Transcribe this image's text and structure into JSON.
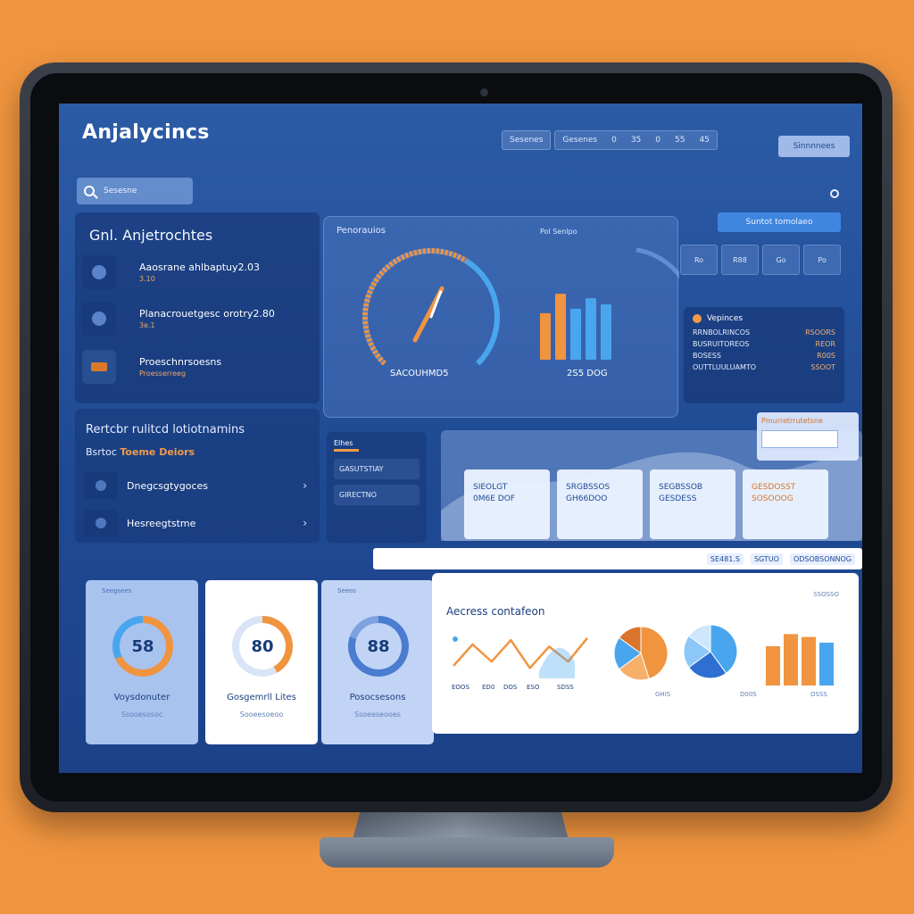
{
  "app": {
    "title": "Anjalycincs"
  },
  "topnav": {
    "items": [
      "Sesenes",
      "Gesenes",
      "0",
      "35",
      "0",
      "55",
      "45"
    ],
    "signin": "Sinnnnees"
  },
  "search": {
    "placeholder": "Sesesne"
  },
  "left_panel": {
    "title": "Gnl. Anjetrochtes",
    "items": [
      {
        "title": "Aaosrane ahlbaptuy2.03",
        "sub": "3.10"
      },
      {
        "title": "Planacrouetgesc orotry2.80",
        "sub": "3e.1"
      },
      {
        "title": "Proeschnrsoesns",
        "sub": "Proesserreeg"
      }
    ]
  },
  "report_panel": {
    "title": "Rertcbr rulitcd lotiotnamins",
    "sub_plain": "Bsrtoc",
    "sub_accent": "Toeme Deiors",
    "rows": [
      "Dnegcsgtygoces",
      "Hesreegtstme"
    ]
  },
  "performance": {
    "title": "Penorauios",
    "side": "Pol   Senlpo",
    "gauge_label": "SACOUHMD5",
    "bar_label": "2S5 DOG",
    "gauge": {
      "value": 0.62
    },
    "bars": [
      {
        "value": 0.62,
        "color": "#f0943f"
      },
      {
        "value": 0.88,
        "color": "#f0943f"
      },
      {
        "value": 0.68,
        "color": "#49a6ee"
      },
      {
        "value": 0.82,
        "color": "#49a6ee"
      },
      {
        "value": 0.74,
        "color": "#49a6ee"
      }
    ]
  },
  "right": {
    "update_button": "Suntot tomolaeo",
    "mini_stats": [
      "Ro",
      "R88",
      "Go",
      "Po"
    ],
    "news_title": "Vepinces",
    "news_rows": [
      {
        "left": "RRNBOLRINCOS",
        "right": "RSOORS"
      },
      {
        "left": "BUSRUITOREOS",
        "right": "REOR"
      },
      {
        "left": "BOSESS",
        "right": "R00S"
      },
      {
        "left": "OUTTLUULUAMTO",
        "right": "SSOOT"
      }
    ]
  },
  "mini_list": {
    "title": "Elhes",
    "rows": [
      "GASUTSTIAY",
      "GIRECTNO"
    ]
  },
  "kpi": {
    "chip_label": "Pmurretrrutetsne",
    "cards": [
      {
        "line1": "SIEOLGT",
        "line2": "0M6E DOF",
        "accent": false
      },
      {
        "line1": "SRGBSSOS",
        "line2": "GH66DOO",
        "accent": false
      },
      {
        "line1": "SEGBSSOB",
        "line2": "GESDESS",
        "accent": false
      },
      {
        "line1": "GESDOSST",
        "line2": "SOSOOOG",
        "accent": true
      }
    ]
  },
  "filter_bar": {
    "items": [
      "SE481.S",
      "SGTUO",
      "ODSOBSONNOG"
    ]
  },
  "stat_cards": [
    {
      "tag": "Seegsees",
      "ring_text": "58",
      "title": "Voysdonuter",
      "sub": "Ssooesosoc",
      "accent": "#f0943f",
      "ring": "#49a6ee",
      "value": 0.68,
      "bg": "#a9c3ef"
    },
    {
      "tag": "",
      "ring_text": "80",
      "title": "Gosgemrll Lites",
      "sub": "Sooeesoeoo",
      "accent": "#f0943f",
      "ring": "#d9e4f7",
      "value": 0.42,
      "bg": "#ffffff"
    },
    {
      "tag": "Seeos",
      "ring_text": "88",
      "title": "Posocsesons",
      "sub": "Ssoeeseooes",
      "accent": "#4a7ccf",
      "ring": "#7ea2e0",
      "value": 0.8,
      "bg": "#c2d4f5"
    }
  ],
  "analytics": {
    "title": "Aecress contafeon",
    "tag": "SSOSSO",
    "x_labels": [
      "EOOS",
      "ED0",
      "DOS",
      "ESO",
      "SDSS"
    ],
    "pie_labels": [
      "GHIS",
      "D00S",
      "OSSS"
    ],
    "line": [
      0.25,
      0.75,
      0.35,
      0.85,
      0.2,
      0.7,
      0.35,
      0.9
    ],
    "pie1": [
      {
        "value": 0.45,
        "color": "#f0943f"
      },
      {
        "value": 0.2,
        "color": "#f7b06a"
      },
      {
        "value": 0.2,
        "color": "#49a6ee"
      },
      {
        "value": 0.15,
        "color": "#d9752a"
      }
    ],
    "pie2": [
      {
        "value": 0.4,
        "color": "#49a6ee"
      },
      {
        "value": 0.25,
        "color": "#2f6fd1"
      },
      {
        "value": 0.2,
        "color": "#8cc7f7"
      },
      {
        "value": 0.15,
        "color": "#cde6fb"
      }
    ],
    "bars": [
      {
        "value": 0.55,
        "color": "#f0943f"
      },
      {
        "value": 0.72,
        "color": "#f0943f"
      },
      {
        "value": 0.68,
        "color": "#f0943f"
      },
      {
        "value": 0.6,
        "color": "#49a6ee"
      }
    ]
  }
}
